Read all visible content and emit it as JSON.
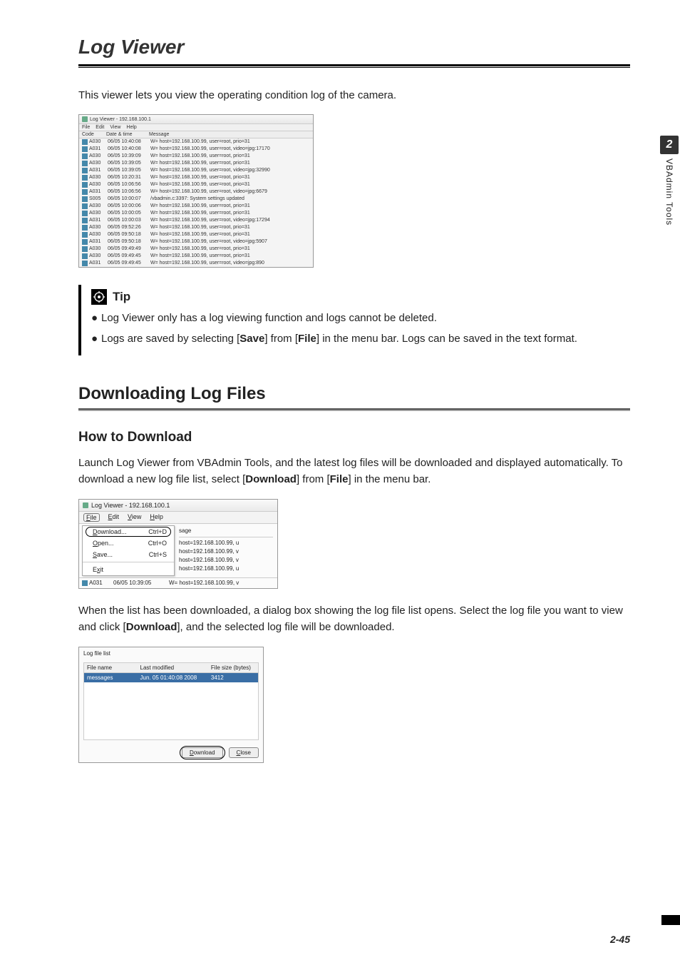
{
  "page": {
    "title": "Log Viewer",
    "intro": "This viewer lets you view the operating condition log of the camera.",
    "section": "Downloading Log Files",
    "subsection": "How to Download",
    "chapter_num": "2",
    "side_label": "VBAdmin Tools",
    "page_num": "2-45"
  },
  "tip": {
    "label": "Tip",
    "items": [
      "Log Viewer only has a log viewing function and logs cannot be deleted.",
      "Logs are saved by selecting [Save] from [File] in the menu bar. Logs can be saved in the text format."
    ]
  },
  "para1": "Launch Log Viewer from VBAdmin Tools, and the latest log files will be downloaded and displayed automatically. To download a new log file list, select [Download] from [File] in the menu bar.",
  "para2": "When the list has been downloaded, a dialog box showing the log file list opens. Select the log file you want to view and click [Download], and the selected log file will be downloaded.",
  "fig1": {
    "title": "Log Viewer - 192.168.100.1",
    "menus": [
      "File",
      "Edit",
      "View",
      "Help"
    ],
    "cols": {
      "code": "Code",
      "date": "Date & time",
      "msg": "Message"
    },
    "rows": [
      {
        "c": "A030",
        "d": "06/05 10:40:08",
        "m": "W= host=192.168.100.99, user=root, prio=31"
      },
      {
        "c": "A031",
        "d": "06/05 10:40:08",
        "m": "W= host=192.168.100.99, user=root, video=jpg:17170"
      },
      {
        "c": "A030",
        "d": "06/05 10:39:09",
        "m": "W= host=192.168.100.99, user=root, prio=31"
      },
      {
        "c": "A030",
        "d": "06/05 10:39:05",
        "m": "W= host=192.168.100.99, user=root, prio=31"
      },
      {
        "c": "A031",
        "d": "06/05 10:39:05",
        "m": "W= host=192.168.100.99, user=root, video=jpg:32990"
      },
      {
        "c": "A030",
        "d": "06/05 10:20:31",
        "m": "W= host=192.168.100.99, user=root, prio=31"
      },
      {
        "c": "A030",
        "d": "06/05 10:06:56",
        "m": "W= host=192.168.100.99, user=root, prio=31"
      },
      {
        "c": "A031",
        "d": "06/05 10:06:56",
        "m": "W= host=192.168.100.99, user=root, video=jpg:6679"
      },
      {
        "c": "S005",
        "d": "06/05 10:00:07",
        "m": "/vbadmin.c:3397: System settings updated"
      },
      {
        "c": "A030",
        "d": "06/05 10:00:06",
        "m": "W= host=192.168.100.99, user=root, prio=31"
      },
      {
        "c": "A030",
        "d": "06/05 10:00:05",
        "m": "W= host=192.168.100.99, user=root, prio=31"
      },
      {
        "c": "A031",
        "d": "06/05 10:00:03",
        "m": "W= host=192.168.100.99, user=root, video=jpg:17294"
      },
      {
        "c": "A030",
        "d": "06/05 09:52:26",
        "m": "W= host=192.168.100.99, user=root, prio=31"
      },
      {
        "c": "A030",
        "d": "06/05 09:50:18",
        "m": "W= host=192.168.100.99, user=root, prio=31"
      },
      {
        "c": "A031",
        "d": "06/05 09:50:18",
        "m": "W= host=192.168.100.99, user=root, video=jpg:5907"
      },
      {
        "c": "A030",
        "d": "06/05 09:49:49",
        "m": "W= host=192.168.100.99, user=root, prio=31"
      },
      {
        "c": "A030",
        "d": "06/05 09:49:45",
        "m": "W= host=192.168.100.99, user=root, prio=31"
      },
      {
        "c": "A031",
        "d": "06/05 09:49:45",
        "m": "W= host=192.168.100.99, user=root, video=jpg:890"
      }
    ]
  },
  "fig2": {
    "title": "Log Viewer - 192.168.100.1",
    "menus": {
      "file": "File",
      "edit": "Edit",
      "view": "View",
      "help": "Help"
    },
    "menu_items": [
      {
        "label": "Download...",
        "short": "Ctrl+D"
      },
      {
        "label": "Open...",
        "short": "Ctrl+O"
      },
      {
        "label": "Save...",
        "short": "Ctrl+S"
      },
      {
        "label": "Exit",
        "short": ""
      }
    ],
    "right_header": "sage",
    "right_rows": [
      "host=192.168.100.99, u",
      "host=192.168.100.99, v",
      "host=192.168.100.99, v",
      "host=192.168.100.99, u"
    ],
    "bottom_row": {
      "c": "A031",
      "d": "06/05 10:39:05",
      "m": "W= host=192.168.100.99, v"
    }
  },
  "fig3": {
    "title": "Log file list",
    "cols": {
      "name": "File name",
      "mod": "Last modified",
      "size": "File size (bytes)"
    },
    "row": {
      "name": "messages",
      "mod": "Jun. 05 01:40:08 2008",
      "size": "3412"
    },
    "buttons": {
      "download": "Download",
      "close": "Close"
    }
  }
}
